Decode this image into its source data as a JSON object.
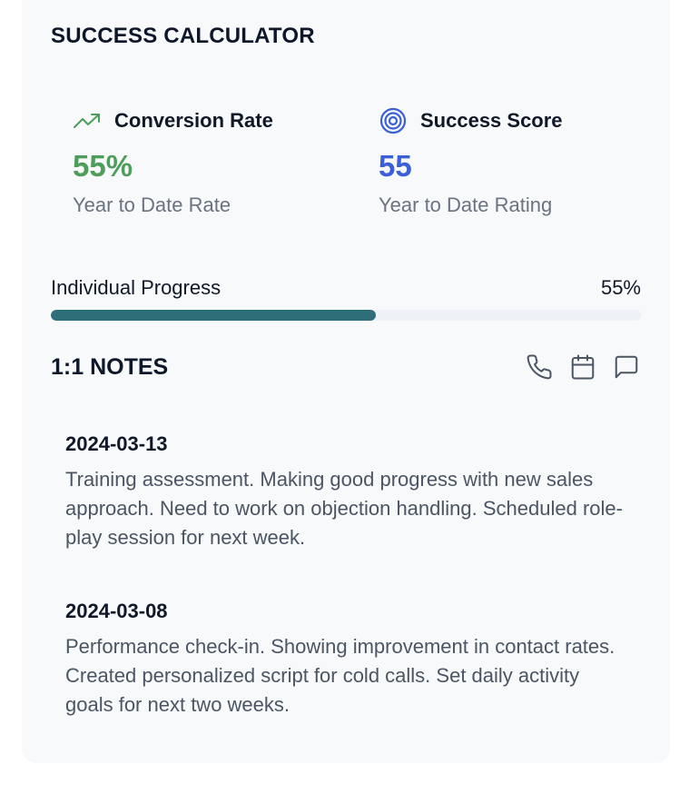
{
  "header": {
    "title": "SUCCESS CALCULATOR"
  },
  "metrics": [
    {
      "label": "Conversion Rate",
      "value": "55%",
      "sub": "Year to Date Rate",
      "icon": "trending-up-icon",
      "color": "#4f9d5a"
    },
    {
      "label": "Success Score",
      "value": "55",
      "sub": "Year to Date Rating",
      "icon": "target-icon",
      "color": "#3b5fd6"
    }
  ],
  "progress": {
    "label": "Individual Progress",
    "value_text": "55%",
    "value": 0.55,
    "color": "#2e6e79"
  },
  "notes": {
    "title": "1:1 NOTES",
    "actions": [
      "phone-icon",
      "calendar-icon",
      "message-icon"
    ],
    "items": [
      {
        "date": "2024-03-13",
        "text": "Training assessment. Making good progress with new sales approach. Need to work on objection handling. Scheduled role-play session for next week."
      },
      {
        "date": "2024-03-08",
        "text": "Performance check-in. Showing improvement in contact rates. Created personalized script for cold calls. Set daily activity goals for next two weeks."
      }
    ]
  }
}
